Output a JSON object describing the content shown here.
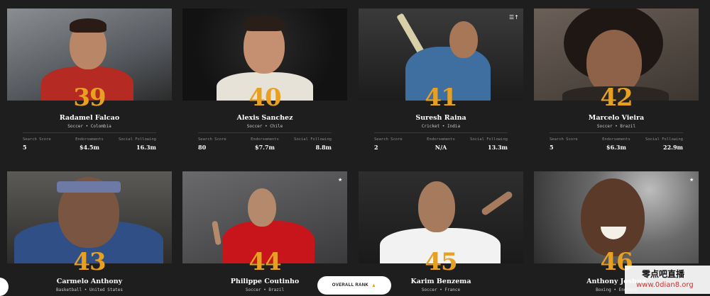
{
  "athletes": [
    {
      "rank": "39",
      "name": "Radamel Falcao",
      "sport": "Soccer • Colombia",
      "search_score": "5",
      "endorsements": "$4.5m",
      "social_following": "16.3m",
      "bg": "#6b6f74",
      "jersey": "#b52a22",
      "skin": "#b98767"
    },
    {
      "rank": "40",
      "name": "Alexis Sanchez",
      "sport": "Soccer • Chile",
      "search_score": "80",
      "endorsements": "$7.7m",
      "social_following": "8.8m",
      "bg": "#141414",
      "jersey": "#e6e2d8",
      "skin": "#c49071"
    },
    {
      "rank": "41",
      "name": "Suresh Raina",
      "sport": "Cricket • India",
      "search_score": "2",
      "endorsements": "N/A",
      "social_following": "13.3m",
      "bg": "#2a2a2a",
      "jersey": "#3f6fa1",
      "skin": "#a87757"
    },
    {
      "rank": "42",
      "name": "Marcelo Vieira",
      "sport": "Soccer • Brazil",
      "search_score": "5",
      "endorsements": "$6.3m",
      "social_following": "22.9m",
      "bg": "#5a4f47",
      "jersey": "#2b2622",
      "skin": "#8d6248"
    },
    {
      "rank": "43",
      "name": "Carmelo Anthony",
      "sport": "Basketball • United States",
      "search_score": "",
      "endorsements": "",
      "social_following": "",
      "bg": "#3e3b39",
      "jersey": "#2f4f86",
      "skin": "#7a5642"
    },
    {
      "rank": "44",
      "name": "Philippe Coutinho",
      "sport": "Soccer • Brazil",
      "search_score": "",
      "endorsements": "",
      "social_following": "",
      "bg": "#4a4a4c",
      "jersey": "#c8151c",
      "skin": "#b58a6c"
    },
    {
      "rank": "45",
      "name": "Karim Benzema",
      "sport": "Soccer • France",
      "search_score": "",
      "endorsements": "",
      "social_following": "",
      "bg": "#292929",
      "jersey": "#f2f2f2",
      "skin": "#a67a5c"
    },
    {
      "rank": "46",
      "name": "Anthony Joshua",
      "sport": "Boxing • England",
      "search_score": "",
      "endorsements": "",
      "social_following": "",
      "bg": "#6a6a6a",
      "jersey": "#1b1b1b",
      "skin": "#5b3a2a"
    }
  ],
  "labels": {
    "search_score": "Search Score",
    "endorsements": "Endorsements",
    "social_following": "Social Following"
  },
  "overall_button": {
    "label": "OVERALL RANK",
    "arrow": "▲"
  },
  "watermark": {
    "line1": "零点吧直播",
    "line2": "www.0dian8.org"
  },
  "colors": {
    "accent": "#e8a020",
    "background": "#1e1e1e"
  }
}
